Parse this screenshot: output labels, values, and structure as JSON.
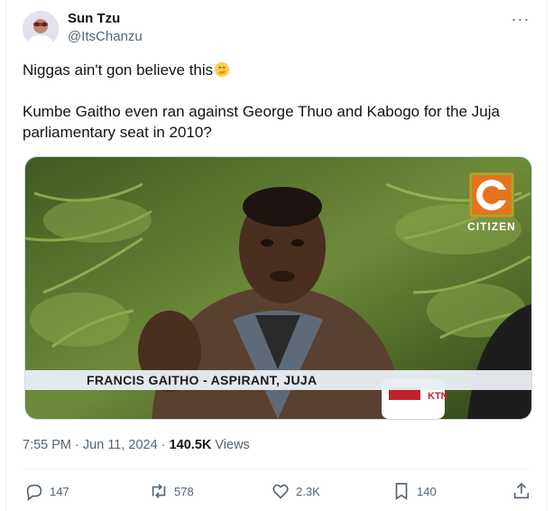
{
  "user": {
    "display_name": "Sun Tzu",
    "handle": "@ItsChanzu"
  },
  "tweet": {
    "line1": "Niggas ain't gon believe this",
    "line2": "Kumbe Gaitho even ran against George Thuo and Kabogo for the Juja parliamentary seat in 2010?"
  },
  "media": {
    "lower_third": "FRANCIS GAITHO - ASPIRANT, JUJA",
    "channel_logo_text": "CITIZEN",
    "mic_text": "KTN"
  },
  "meta": {
    "time": "7:55 PM",
    "date": "Jun 11, 2024",
    "separator": "·",
    "views_count": "140.5K",
    "views_label": "Views"
  },
  "actions": {
    "replies": "147",
    "reposts": "578",
    "likes": "2.3K",
    "bookmarks": "140"
  },
  "colors": {
    "text_primary": "#0f1419",
    "text_secondary": "#536471",
    "border": "#eff3f4"
  },
  "icons": [
    "more-icon",
    "reply-icon",
    "repost-icon",
    "like-icon",
    "bookmark-icon",
    "share-icon"
  ]
}
